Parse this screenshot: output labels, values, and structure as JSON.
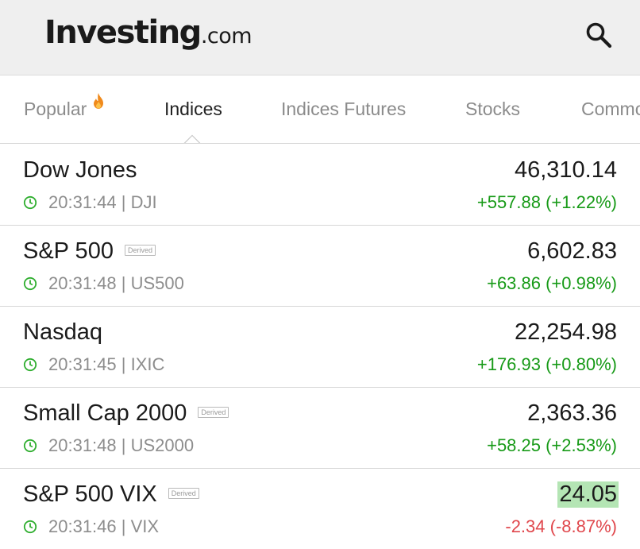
{
  "header": {
    "logo_main": "Investing",
    "logo_suffix": ".com",
    "search_icon": "search-icon"
  },
  "tabs": [
    {
      "label": "Popular",
      "icon": "fire-icon",
      "active": false
    },
    {
      "label": "Indices",
      "active": true
    },
    {
      "label": "Indices Futures",
      "active": false
    },
    {
      "label": "Stocks",
      "active": false
    },
    {
      "label": "Commodities",
      "active": false
    }
  ],
  "rows": [
    {
      "name": "Dow Jones",
      "derived": "",
      "time": "20:31:44",
      "symbol": "DJI",
      "meta": "20:31:44 | DJI",
      "price": "46,310.14",
      "change": "+557.88 (+1.22%)",
      "direction": "up",
      "highlight": false
    },
    {
      "name": "S&P 500",
      "derived": "Derived",
      "time": "20:31:48",
      "symbol": "US500",
      "meta": "20:31:48 | US500",
      "price": "6,602.83",
      "change": "+63.86 (+0.98%)",
      "direction": "up",
      "highlight": false
    },
    {
      "name": "Nasdaq",
      "derived": "",
      "time": "20:31:45",
      "symbol": "IXIC",
      "meta": "20:31:45 | IXIC",
      "price": "22,254.98",
      "change": "+176.93 (+0.80%)",
      "direction": "up",
      "highlight": false
    },
    {
      "name": "Small Cap 2000",
      "derived": "Derived",
      "time": "20:31:48",
      "symbol": "US2000",
      "meta": "20:31:48 | US2000",
      "price": "2,363.36",
      "change": "+58.25 (+2.53%)",
      "direction": "up",
      "highlight": false
    },
    {
      "name": "S&P 500 VIX",
      "derived": "Derived",
      "time": "20:31:46",
      "symbol": "VIX",
      "meta": "20:31:46 | VIX",
      "price": "24.05",
      "change": "-2.34 (-8.87%)",
      "direction": "down",
      "highlight": true
    }
  ],
  "colors": {
    "up": "#179a17",
    "down": "#e0474c",
    "highlight": "#b4e5b4",
    "clock": "#2fae2f"
  }
}
